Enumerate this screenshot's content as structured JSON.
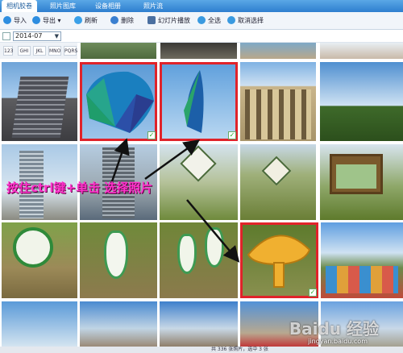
{
  "tabs": [
    {
      "label": "相机胶卷",
      "active": true
    },
    {
      "label": "照片图库",
      "active": false
    },
    {
      "label": "设备相册",
      "active": false
    },
    {
      "label": "照片流",
      "active": false
    }
  ],
  "toolbar": {
    "import_label": "导入",
    "export_label": "导出",
    "refresh_label": "刷新",
    "delete_label": "删除",
    "slideshow_label": "幻灯片播放",
    "select_all_label": "全选",
    "cancel_select_label": "取消选择"
  },
  "filter": {
    "date_value": "2014-07"
  },
  "alpha_buttons": [
    "123",
    "GHI",
    "JKL",
    "MNO",
    "PQRS"
  ],
  "annotation": "按住ctrl键+单击 选择照片",
  "watermark": {
    "brand": "Baidu 经验",
    "url": "jingyan.baidu.com"
  },
  "statusbar": "共 336 张照片，选中 3 张",
  "colors": {
    "selection": "#e0232a",
    "annotation": "#ff33cc",
    "tab_bar": "#2e7fcf"
  },
  "photos": [
    {
      "name": "photo-1",
      "selected": false
    },
    {
      "name": "photo-umbrella-1",
      "selected": true
    },
    {
      "name": "photo-umbrella-2",
      "selected": true
    },
    {
      "name": "photo-sign-mushroom",
      "selected": true
    }
  ]
}
